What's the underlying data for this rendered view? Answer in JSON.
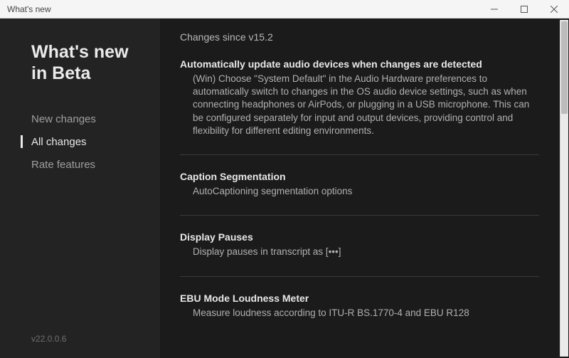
{
  "window": {
    "title": "What's new"
  },
  "sidebar": {
    "heading_line1": "What's new",
    "heading_line2": "in Beta",
    "nav": [
      {
        "label": "New changes",
        "active": false
      },
      {
        "label": "All changes",
        "active": true
      },
      {
        "label": "Rate features",
        "active": false
      }
    ],
    "version": "v22.0.0.6"
  },
  "content": {
    "since_label": "Changes since v15.2",
    "sections": [
      {
        "title": "Automatically update audio devices when changes are detected",
        "body": "(Win) Choose \"System Default\" in the Audio Hardware preferences to automatically switch to changes in the OS audio device settings, such as when connecting headphones or AirPods, or plugging in a USB microphone.  This can be configured separately for input and output devices, providing control and flexibility for different editing environments."
      },
      {
        "title": "Caption Segmentation",
        "body": "AutoCaptioning segmentation options"
      },
      {
        "title": "Display Pauses",
        "body": "Display pauses in transcript as [•••]"
      },
      {
        "title": "EBU Mode Loudness Meter",
        "body": "Measure loudness according to ITU-R BS.1770-4 and EBU R128"
      }
    ]
  }
}
